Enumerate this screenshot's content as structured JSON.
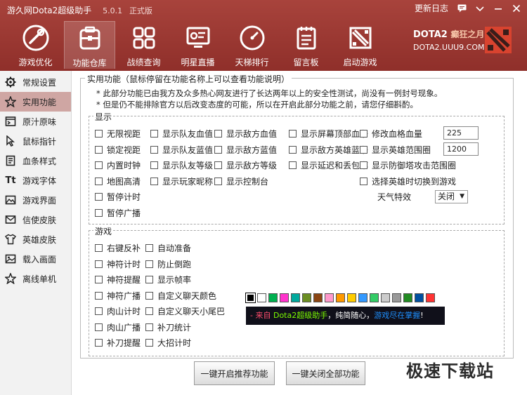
{
  "window": {
    "title": "游久网Dota2超级助手",
    "version": "5.0.1",
    "edition": "正式版",
    "update_log": "更新日志"
  },
  "colors": {
    "header": "#9a3a34",
    "sidebar_active": "#cfa6a3",
    "preview_bg": "#10101a"
  },
  "nav": [
    {
      "label": "游戏优化",
      "icon": "game-optimize-icon"
    },
    {
      "label": "功能仓库",
      "icon": "toolbox-icon"
    },
    {
      "label": "战绩查询",
      "icon": "grid-icon"
    },
    {
      "label": "明星直播",
      "icon": "stream-icon"
    },
    {
      "label": "天梯排行",
      "icon": "gauge-icon"
    },
    {
      "label": "留言板",
      "icon": "notepad-icon"
    },
    {
      "label": "启动游戏",
      "icon": "dota-icon"
    }
  ],
  "brand": {
    "line1": "DOTA2",
    "line1_accent": "癫狂之月",
    "line2": "DOTA2.UUU9.COM"
  },
  "sidebar": [
    {
      "label": "常规设置",
      "icon": "gear-icon"
    },
    {
      "label": "实用功能",
      "icon": "star-icon"
    },
    {
      "label": "原汁原味",
      "icon": "window-icon"
    },
    {
      "label": "鼠标指针",
      "icon": "cursor-icon"
    },
    {
      "label": "血条样式",
      "icon": "document-icon"
    },
    {
      "label": "游戏字体",
      "icon": "font-icon"
    },
    {
      "label": "游戏界面",
      "icon": "image-icon"
    },
    {
      "label": "信使皮肤",
      "icon": "mail-icon"
    },
    {
      "label": "英雄皮肤",
      "icon": "shirt-icon"
    },
    {
      "label": "载入画面",
      "icon": "picture-icon"
    },
    {
      "label": "离线单机",
      "icon": "star-outline-icon"
    }
  ],
  "main": {
    "title": "实用功能（鼠标停留在功能名称上可以查看功能说明）",
    "note1": "* 此部分功能已由我方及众多热心网友进行了长达两年以上的安全性测试，尚没有一例封号现象。",
    "note2": "* 但是仍不能排除官方以后改变态度的可能，所以在开启此部分功能之前，请您仔细斟酌。",
    "display": {
      "title": "显示",
      "col1": [
        "无限视距",
        "锁定视距",
        "内置时钟",
        "地图高清",
        "暂停计时",
        "暂停广播"
      ],
      "col2": [
        "显示队友血值",
        "显示队友蓝值",
        "显示队友等级",
        "显示玩家昵称"
      ],
      "col3": [
        "显示敌方血值",
        "显示敌方蓝值",
        "显示敌方等级",
        "显示控制台"
      ],
      "col4": [
        "显示屏幕顶部血条",
        "显示敌方英雄蓝条",
        "显示延迟和丢包率"
      ],
      "col5": [
        "修改血格血量",
        "显示英雄范围圈",
        "显示防御塔攻击范围圈",
        "选择英雄时切换到游戏"
      ],
      "hp_value": "225",
      "range_value": "1200",
      "weather_label": "天气特效",
      "weather_value": "关闭"
    },
    "game": {
      "title": "游戏",
      "col1": [
        "右键反补",
        "神符计时",
        "神符提醒",
        "神符广播",
        "肉山计时",
        "肉山广播",
        "补刀提醒"
      ],
      "col2": [
        "自动准备",
        "防止倒跑",
        "显示帧率",
        "自定义聊天颜色",
        "自定义聊天小尾巴",
        "补刀统计",
        "大招计时"
      ],
      "swatch_colors": [
        "#000000",
        "#ffffff",
        "#00b050",
        "#ff33cc",
        "#00a99d",
        "#6b8e23",
        "#8b4513",
        "#ff99cc",
        "#ff9900",
        "#ffcc00",
        "#3399ff",
        "#33cc66",
        "#cccccc",
        "#999999",
        "#228b22",
        "#0050a0",
        "#ff3333"
      ],
      "preview": {
        "part1": "- 来自 ",
        "part2": "Dota2超级助手",
        "part3": "，纯简随心，",
        "part4": "游戏尽在掌握",
        "part5": "!"
      }
    },
    "buttons": {
      "enable_recommended": "一键开启推荐功能",
      "disable_all": "一键关闭全部功能"
    }
  },
  "watermark": "极速下载站"
}
